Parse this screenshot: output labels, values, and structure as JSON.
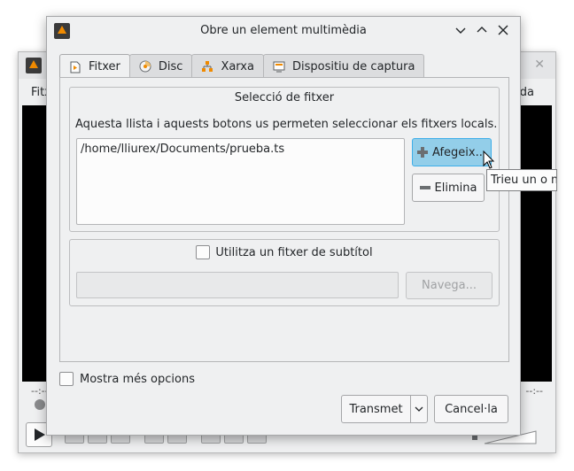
{
  "background_window": {
    "menu_left": "Fitx",
    "menu_right": "da",
    "time_elapsed": "--:--",
    "time_total": "--:--"
  },
  "dialog": {
    "title": "Obre un element multimèdia",
    "tabs": [
      {
        "label": "Fitxer",
        "icon": "file-icon",
        "active": true
      },
      {
        "label": "Disc",
        "icon": "disc-icon",
        "active": false
      },
      {
        "label": "Xarxa",
        "icon": "network-icon",
        "active": false
      },
      {
        "label": "Dispositiu de captura",
        "icon": "capture-device-icon",
        "active": false
      }
    ],
    "file_selection": {
      "title": "Selecció de fitxer",
      "description": "Aquesta llista i aquests botons us permeten seleccionar els fitxers locals.",
      "files": [
        "/home/lliurex/Documents/prueba.ts"
      ],
      "add_label": "Afegeix...",
      "remove_label": "Elimina"
    },
    "subtitle": {
      "checkbox_label": "Utilitza un fitxer de subtítol",
      "checked": false,
      "path_value": "",
      "browse_label": "Navega..."
    },
    "more_options_label": "Mostra més opcions",
    "more_options_checked": false,
    "play_label": "Transmet",
    "cancel_label": "Cancel·la"
  },
  "tooltip": {
    "text": "Trieu un o m"
  },
  "colors": {
    "window_bg": "#eff0f1",
    "accent": "#3daee9",
    "primary_button": "#93cee9",
    "vlc_orange": "#f08a00"
  }
}
